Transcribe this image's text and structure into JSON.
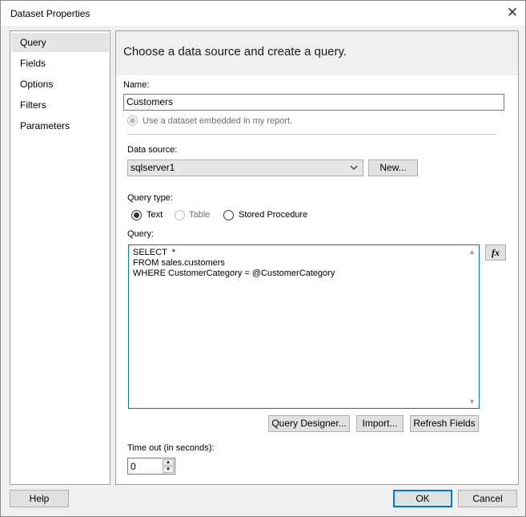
{
  "window": {
    "title": "Dataset Properties",
    "close_glyph": "✕"
  },
  "nav": {
    "items": [
      {
        "label": "Query",
        "selected": true
      },
      {
        "label": "Fields"
      },
      {
        "label": "Options"
      },
      {
        "label": "Filters"
      },
      {
        "label": "Parameters"
      }
    ]
  },
  "content": {
    "heading": "Choose a data source and create a query.",
    "name_label": "Name:",
    "name_value": "Customers",
    "embedded_option": "Use a dataset embedded in my report.",
    "data_source_label": "Data source:",
    "data_source_value": "sqlserver1",
    "new_button": "New...",
    "query_type_label": "Query type:",
    "query_types": {
      "text": "Text",
      "table": "Table",
      "stored_procedure": "Stored Procedure"
    },
    "query_type_selected": "Text",
    "query_label": "Query:",
    "query_lines": [
      "SELECT  *",
      "FROM sales.customers",
      "WHERE CustomerCategory = @CustomerCategory"
    ],
    "expression_button": "fx",
    "query_designer_button": "Query Designer...",
    "import_button": "Import...",
    "refresh_fields_button": "Refresh Fields",
    "timeout_label": "Time out (in seconds):",
    "timeout_value": "0"
  },
  "footer": {
    "help_button": "Help",
    "ok_button": "OK",
    "cancel_button": "Cancel"
  }
}
